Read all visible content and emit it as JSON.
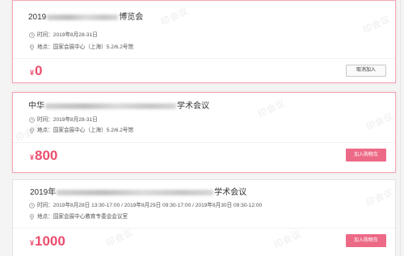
{
  "watermark_text": "印会议",
  "labels": {
    "time": "时间：",
    "location": "地点："
  },
  "colors": {
    "accent": "#ec4d6d",
    "button": "#ec6a86",
    "selected_border": "#f2a7b5",
    "border": "#e3e3e3"
  },
  "events": [
    {
      "highlighted": true,
      "title_start": "2019",
      "title_end": "博览会",
      "time": "2019年8月28-31日",
      "location": "国家会展中心（上海）5.2/6.2号馆",
      "currency": "¥",
      "price": "0",
      "action": "取消加入"
    },
    {
      "highlighted": true,
      "title_start": "中华",
      "title_end": "学术会议",
      "time": "2019年8月28-31日",
      "location": "国家会展中心（上海）5.2/6.2号馆",
      "currency": "¥",
      "price": "800",
      "action": "加入购物车"
    },
    {
      "highlighted": false,
      "title_start": "2019年",
      "title_end": "学术会议",
      "time": "2019年8月28日 13:30-17:00 / 2019年8月29日 09:30-17:00 / 2019年8月30日 09:30-12:00",
      "location": "国家会展中心教育专委会会议室",
      "currency": "¥",
      "price": "1000",
      "action": "加入购物车"
    }
  ]
}
